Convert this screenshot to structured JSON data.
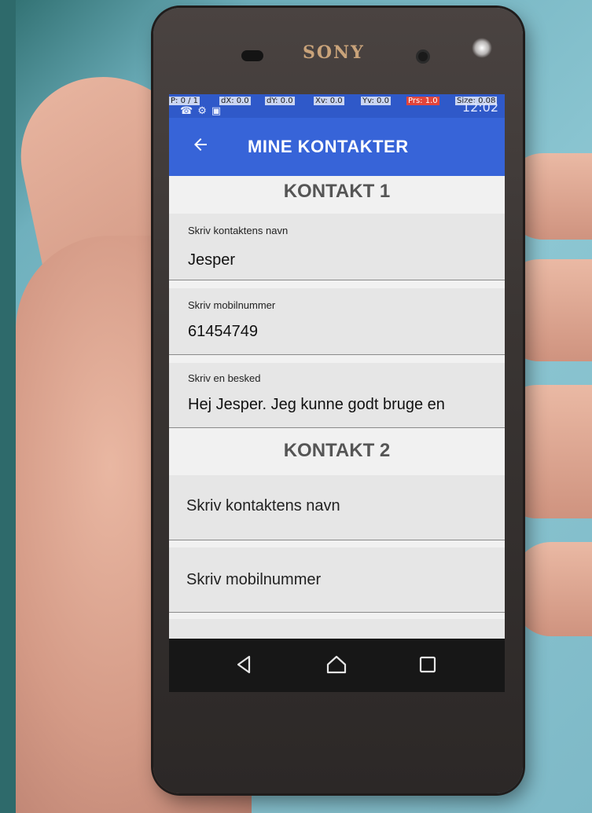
{
  "device": {
    "brand": "SONY"
  },
  "status_bar": {
    "pointer_info": [
      "P: 0 / 1",
      "dX: 0.0",
      "dY: 0.0",
      "Xv: 0.0",
      "Yv: 0.0",
      "Prs: 1.0",
      "Size: 0.08"
    ],
    "time": "12:02"
  },
  "app_bar": {
    "title": "MINE KONTAKTER"
  },
  "contact1": {
    "heading": "KONTAKT 1",
    "name_label": "Skriv kontaktens navn",
    "name_value": "Jesper",
    "mobile_label": "Skriv mobilnummer",
    "mobile_value": "61454749",
    "message_label": "Skriv en besked",
    "message_value": "Hej Jesper. Jeg kunne godt bruge en"
  },
  "contact2": {
    "heading": "KONTAKT 2",
    "name_placeholder": "Skriv kontaktens navn",
    "mobile_placeholder": "Skriv mobilnummer"
  },
  "nav_bar": {
    "icons": [
      "back-icon",
      "home-icon",
      "recents-icon"
    ]
  },
  "colors": {
    "app_bar": "#3764d8",
    "status_bar": "#2f59c9",
    "field_bg": "#e6e6e6",
    "nav_bar": "#171717"
  }
}
